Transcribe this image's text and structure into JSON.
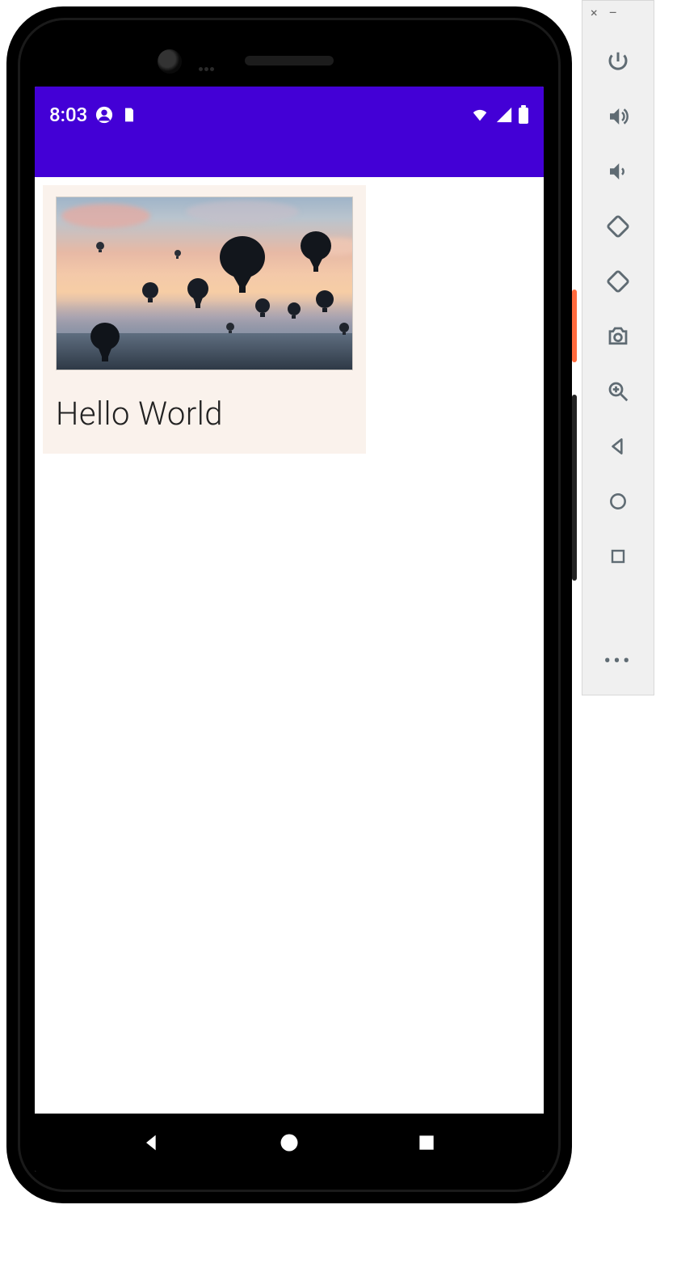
{
  "statusbar": {
    "time": "8:03",
    "icons_left": [
      "profile-icon",
      "sd-card-icon"
    ],
    "icons_right": [
      "wifi-icon",
      "cell-signal-icon",
      "battery-icon"
    ]
  },
  "card": {
    "image_alt": "hot-air-balloons-sunset",
    "title": "Hello World"
  },
  "navbar": {
    "back": "back",
    "home": "home",
    "recent": "recent"
  },
  "emulator_toolbar": {
    "window": {
      "close": "close",
      "minimize": "minimize"
    },
    "buttons": [
      "power-icon",
      "volume-up-icon",
      "volume-down-icon",
      "rotate-left-icon",
      "rotate-right-icon",
      "camera-icon",
      "zoom-icon",
      "back-icon",
      "home-icon",
      "overview-icon"
    ],
    "more": "more-icon"
  }
}
